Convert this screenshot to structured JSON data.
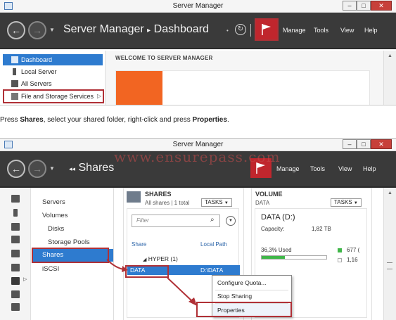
{
  "window1": {
    "title": "Server Manager",
    "controls": {
      "minimize": "–",
      "maximize": "□",
      "close": "✕"
    },
    "header": {
      "breadcrumb_app": "Server Manager",
      "breadcrumb_sep": "▸",
      "breadcrumb_page": "Dashboard",
      "menu": [
        "Manage",
        "Tools",
        "View",
        "Help"
      ]
    },
    "sidebar": {
      "items": [
        {
          "label": "Dashboard",
          "selected": true
        },
        {
          "label": "Local Server",
          "selected": false
        },
        {
          "label": "All Servers",
          "selected": false
        },
        {
          "label": "File and Storage Services",
          "selected": false
        }
      ],
      "expand_glyph": "▷"
    },
    "main": {
      "welcome": "WELCOME TO SERVER MANAGER"
    }
  },
  "instruction": {
    "prefix": "Press ",
    "bold1": "Shares",
    "middle": ", select your shared folder, right-click and press ",
    "bold2": "Properties",
    "suffix": "."
  },
  "window2": {
    "title": "Server Manager",
    "controls": {
      "minimize": "–",
      "maximize": "□",
      "close": "✕"
    },
    "header": {
      "section_glyph": "◂◂",
      "section": "Shares",
      "menu": [
        "Manage",
        "Tools",
        "View",
        "Help"
      ]
    },
    "watermark": "www.ensurepass.com",
    "nav": {
      "items": [
        "Servers",
        "Volumes",
        "Disks",
        "Storage Pools",
        "Shares",
        "iSCSI"
      ],
      "selected": "Shares"
    },
    "shares": {
      "title": "SHARES",
      "subtitle": "All shares | 1 total",
      "tasks": "TASKS",
      "filter_placeholder": "Filter",
      "columns": [
        "Share",
        "Local Path"
      ],
      "group": "HYPER (1)",
      "row": {
        "share": "DATA",
        "path": "D:\\DATA"
      }
    },
    "context_menu": [
      "Configure Quota...",
      "Stop Sharing",
      "Properties"
    ],
    "volume": {
      "title": "VOLUME",
      "subtitle": "DATA",
      "tasks": "TASKS",
      "name": "DATA (D:)",
      "capacity_label": "Capacity:",
      "capacity_value": "1,82 TB",
      "used_label": "36,3% Used",
      "used_fraction": 0.363,
      "legend_used": "677 (",
      "legend_free": "1,16"
    }
  }
}
